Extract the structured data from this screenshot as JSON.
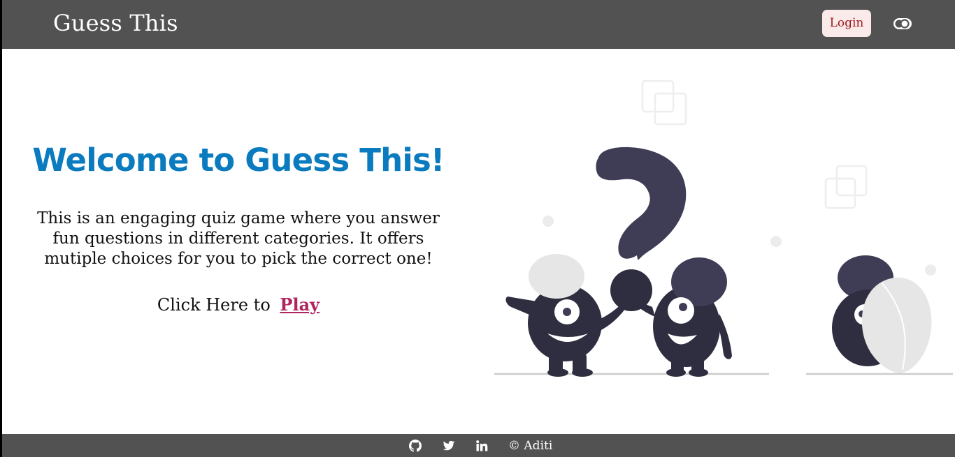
{
  "app": {
    "brand": "Guess This"
  },
  "navbar": {
    "login_label": "Login",
    "toggle_icon": "toggle-icon"
  },
  "hero": {
    "title": "Welcome to Guess This!",
    "description": "This is an engaging quiz game where you answer fun questions in different categories. It offers mutiple choices for you to pick the correct one!",
    "cta_prefix": "Click Here to",
    "cta_link": "Play"
  },
  "footer": {
    "icons": [
      "github-icon",
      "twitter-icon",
      "linkedin-icon"
    ],
    "copyright": "© Aditi"
  },
  "colors": {
    "navbar_bg": "#525252",
    "title_blue": "#0a7bbf",
    "play_link": "#b0245f",
    "login_bg": "#fbeaea",
    "login_text": "#9b1c1c"
  }
}
